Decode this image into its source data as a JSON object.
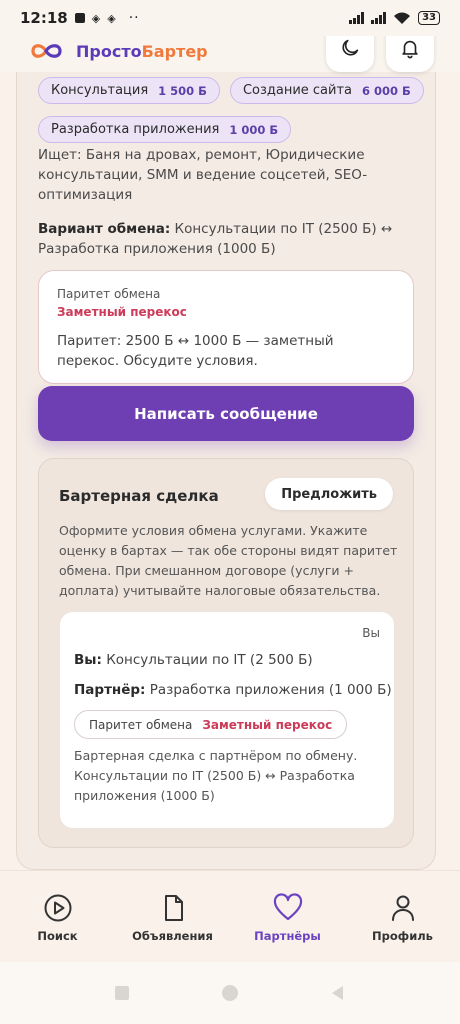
{
  "status_bar": {
    "time": "12:18",
    "dots": "··",
    "battery": "33"
  },
  "header": {
    "brand_part1": "Просто",
    "brand_part2": "Бартер",
    "icons": [
      "logo-icon",
      "moon-icon",
      "bell-icon"
    ]
  },
  "listing": {
    "chips": [
      {
        "label": "Консультация",
        "price": "1 500 Б"
      },
      {
        "label": "Создание сайта",
        "price": "6 000 Б"
      },
      {
        "label": "Разработка приложения",
        "price": "1 000 Б"
      }
    ],
    "wants": "Ищет: Баня на дровах, ремонт, Юридические консультации, SMM и ведение соцсетей, SEO-оптимизация",
    "variant_label": "Вариант обмена:",
    "variant_value": " Консультации по IT (2500 Б) ↔ Разработка приложения (1000 Б)"
  },
  "parity": {
    "title": "Паритет обмена",
    "status": "Заметный перекос",
    "text": "Паритет: 2500 Б ↔ 1000 Б — заметный перекос. Обсудите условия."
  },
  "write_button": "Написать сообщение",
  "deal": {
    "title": "Бартерная сделка",
    "propose_button": "Предложить",
    "description": "Оформите условия обмена услугами. Укажите оценку в бартах — так обе стороны видят паритет обмена. При смешанном договоре (услуги + доплата) учитывайте налоговые обязательства.",
    "offer": {
      "author": "Вы",
      "you_label": "Вы:",
      "you_value": " Консультации по IT (2 500 Б)",
      "partner_label": "Партнёр:",
      "partner_value": " Разработка приложения (1 000 Б)",
      "parity_label": "Паритет обмена",
      "parity_status": "Заметный перекос",
      "text": "Бартерная сделка с партнёром по обмену. Консультации по IT (2500 Б) ↔ Разработка приложения (1000 Б)"
    }
  },
  "nav": {
    "items": [
      {
        "label": "Поиск",
        "icon": "play-icon"
      },
      {
        "label": "Объявления",
        "icon": "document-icon"
      },
      {
        "label": "Партнёры",
        "icon": "heart-icon",
        "active": true
      },
      {
        "label": "Профиль",
        "icon": "user-icon"
      }
    ]
  },
  "colors": {
    "accent": "#6e3eb3",
    "brand_orange": "#ef7a3c",
    "warning": "#cc3c5a",
    "background": "#f9f1ea"
  }
}
